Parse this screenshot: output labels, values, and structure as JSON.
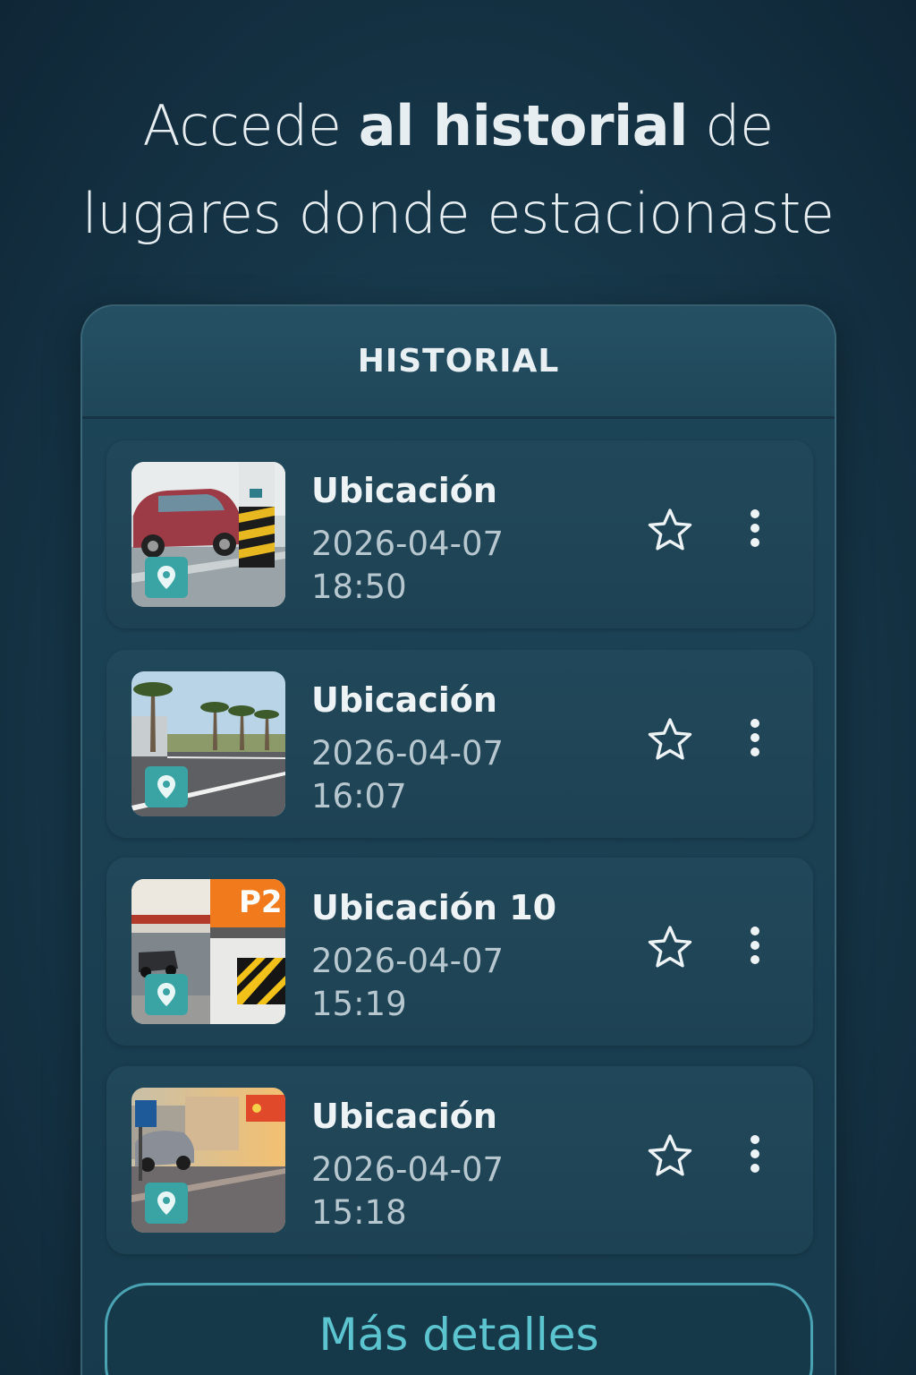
{
  "headline": {
    "part1": "Accede ",
    "bold": "al historial",
    "part2": " de",
    "line2": "lugares donde estacionaste"
  },
  "panel": {
    "title": "HISTORIAL"
  },
  "entries": [
    {
      "title": "Ubicación",
      "date": "2026-04-07",
      "time": "18:50",
      "favorite": false
    },
    {
      "title": "Ubicación",
      "date": "2026-04-07",
      "time": "16:07",
      "favorite": false
    },
    {
      "title": "Ubicación 10",
      "date": "2026-04-07",
      "time": "15:19",
      "favorite": false
    },
    {
      "title": "Ubicación",
      "date": "2026-04-07",
      "time": "15:18",
      "favorite": false
    }
  ],
  "thumb_badges": {
    "entry3": "P2"
  },
  "more_button": {
    "label": "Más detalles"
  },
  "colors": {
    "background": "#17394b",
    "accent": "#5cc4cf",
    "pin": "#3aa4a4"
  },
  "icons": [
    "location-pin-icon",
    "star-outline-icon",
    "more-vert-icon"
  ]
}
